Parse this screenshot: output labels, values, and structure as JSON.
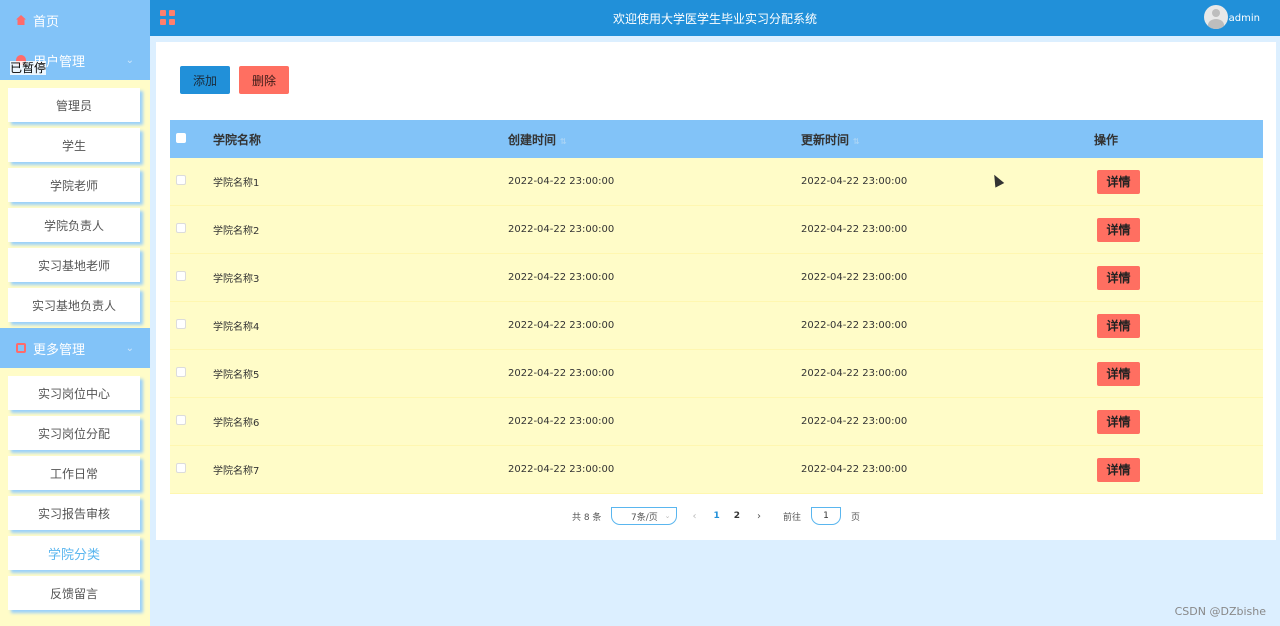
{
  "sidebar": {
    "home_label": "首页",
    "user_group_label": "用户管理",
    "paused_overlay": "已暂停",
    "user_items": [
      "管理员",
      "学生",
      "学院老师",
      "学院负责人",
      "实习基地老师",
      "实习基地负责人"
    ],
    "more_group_label": "更多管理",
    "more_items": [
      "实习岗位中心",
      "实习岗位分配",
      "工作日常",
      "实习报告审核",
      "学院分类",
      "反馈留言"
    ],
    "active_item": "学院分类"
  },
  "topbar": {
    "title": "欢迎使用大学医学生毕业实习分配系统",
    "username": "admin"
  },
  "toolbar": {
    "add_label": "添加",
    "delete_label": "删除"
  },
  "table": {
    "headers": {
      "name": "学院名称",
      "created": "创建时间",
      "updated": "更新时间",
      "ops": "操作"
    },
    "detail_label": "详情",
    "rows": [
      {
        "name": "学院名称1",
        "created": "2022-04-22 23:00:00",
        "updated": "2022-04-22 23:00:00"
      },
      {
        "name": "学院名称2",
        "created": "2022-04-22 23:00:00",
        "updated": "2022-04-22 23:00:00"
      },
      {
        "name": "学院名称3",
        "created": "2022-04-22 23:00:00",
        "updated": "2022-04-22 23:00:00"
      },
      {
        "name": "学院名称4",
        "created": "2022-04-22 23:00:00",
        "updated": "2022-04-22 23:00:00"
      },
      {
        "name": "学院名称5",
        "created": "2022-04-22 23:00:00",
        "updated": "2022-04-22 23:00:00"
      },
      {
        "name": "学院名称6",
        "created": "2022-04-22 23:00:00",
        "updated": "2022-04-22 23:00:00"
      },
      {
        "name": "学院名称7",
        "created": "2022-04-22 23:00:00",
        "updated": "2022-04-22 23:00:00"
      }
    ]
  },
  "pagination": {
    "total": "共 8 条",
    "page_size": "7条/页",
    "pages": [
      "1",
      "2"
    ],
    "current_page": "1",
    "goto_label": "前往",
    "goto_value": "1",
    "page_suffix": "页"
  },
  "watermark": "CSDN @DZbishe"
}
